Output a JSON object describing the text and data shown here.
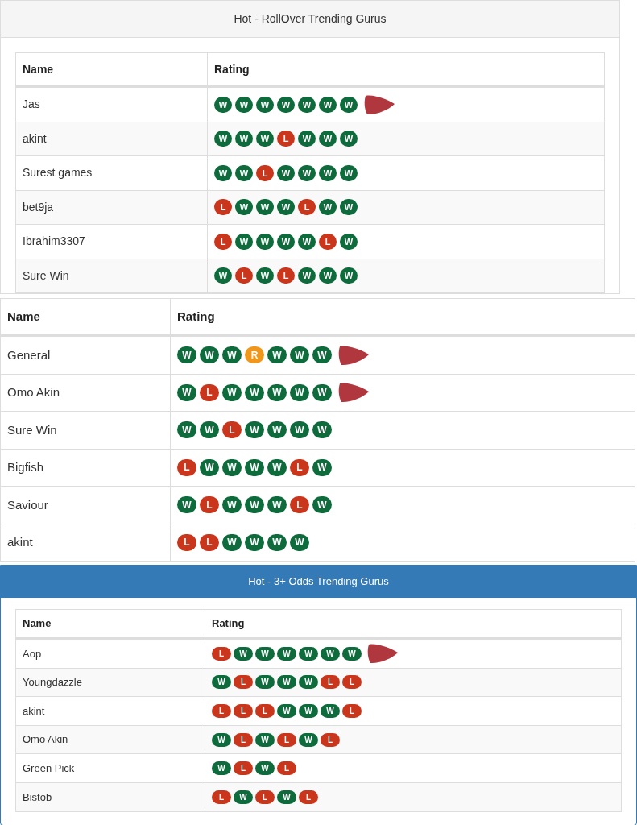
{
  "sections": [
    {
      "kind": "gray-panel",
      "title": "Hot - RollOver Trending Gurus",
      "columns": [
        "Name",
        "Rating"
      ],
      "rows": [
        {
          "name": "Jas",
          "marked": true,
          "results": [
            {
              "label": "W",
              "color": "#0d6b3c"
            },
            {
              "label": "W",
              "color": "#0d6b3c"
            },
            {
              "label": "W",
              "color": "#0d6b3c"
            },
            {
              "label": "W",
              "color": "#0d6b3c"
            },
            {
              "label": "W",
              "color": "#0d6b3c"
            },
            {
              "label": "W",
              "color": "#0d6b3c"
            },
            {
              "label": "W",
              "color": "#0d6b3c"
            }
          ]
        },
        {
          "name": "akint",
          "marked": false,
          "results": [
            {
              "label": "W",
              "color": "#0d6b3c"
            },
            {
              "label": "W",
              "color": "#0d6b3c"
            },
            {
              "label": "W",
              "color": "#0d6b3c"
            },
            {
              "label": "L",
              "color": "#c9361c"
            },
            {
              "label": "W",
              "color": "#0d6b3c"
            },
            {
              "label": "W",
              "color": "#0d6b3c"
            },
            {
              "label": "W",
              "color": "#0d6b3c"
            }
          ]
        },
        {
          "name": "Surest games",
          "marked": false,
          "results": [
            {
              "label": "W",
              "color": "#0d6b3c"
            },
            {
              "label": "W",
              "color": "#0d6b3c"
            },
            {
              "label": "L",
              "color": "#c9361c"
            },
            {
              "label": "W",
              "color": "#0d6b3c"
            },
            {
              "label": "W",
              "color": "#0d6b3c"
            },
            {
              "label": "W",
              "color": "#0d6b3c"
            },
            {
              "label": "W",
              "color": "#0d6b3c"
            }
          ]
        },
        {
          "name": "bet9ja",
          "marked": false,
          "results": [
            {
              "label": "L",
              "color": "#c9361c"
            },
            {
              "label": "W",
              "color": "#0d6b3c"
            },
            {
              "label": "W",
              "color": "#0d6b3c"
            },
            {
              "label": "W",
              "color": "#0d6b3c"
            },
            {
              "label": "L",
              "color": "#c9361c"
            },
            {
              "label": "W",
              "color": "#0d6b3c"
            },
            {
              "label": "W",
              "color": "#0d6b3c"
            }
          ]
        },
        {
          "name": "Ibrahim3307",
          "marked": false,
          "results": [
            {
              "label": "L",
              "color": "#c9361c"
            },
            {
              "label": "W",
              "color": "#0d6b3c"
            },
            {
              "label": "W",
              "color": "#0d6b3c"
            },
            {
              "label": "W",
              "color": "#0d6b3c"
            },
            {
              "label": "W",
              "color": "#0d6b3c"
            },
            {
              "label": "L",
              "color": "#c9361c"
            },
            {
              "label": "W",
              "color": "#0d6b3c"
            }
          ]
        },
        {
          "name": "Sure Win",
          "marked": false,
          "results": [
            {
              "label": "W",
              "color": "#0d6b3c"
            },
            {
              "label": "L",
              "color": "#c9361c"
            },
            {
              "label": "W",
              "color": "#0d6b3c"
            },
            {
              "label": "L",
              "color": "#c9361c"
            },
            {
              "label": "W",
              "color": "#0d6b3c"
            },
            {
              "label": "W",
              "color": "#0d6b3c"
            },
            {
              "label": "W",
              "color": "#0d6b3c"
            }
          ]
        }
      ]
    },
    {
      "kind": "plain",
      "columns": [
        "Name",
        "Rating"
      ],
      "rows": [
        {
          "name": "General",
          "marked": true,
          "results": [
            {
              "label": "W",
              "color": "#0d6b3c"
            },
            {
              "label": "W",
              "color": "#0d6b3c"
            },
            {
              "label": "W",
              "color": "#0d6b3c"
            },
            {
              "label": "R",
              "color": "#f0961a"
            },
            {
              "label": "W",
              "color": "#0d6b3c"
            },
            {
              "label": "W",
              "color": "#0d6b3c"
            },
            {
              "label": "W",
              "color": "#0d6b3c"
            }
          ]
        },
        {
          "name": "Omo Akin",
          "marked": true,
          "results": [
            {
              "label": "W",
              "color": "#0d6b3c"
            },
            {
              "label": "L",
              "color": "#c9361c"
            },
            {
              "label": "W",
              "color": "#0d6b3c"
            },
            {
              "label": "W",
              "color": "#0d6b3c"
            },
            {
              "label": "W",
              "color": "#0d6b3c"
            },
            {
              "label": "W",
              "color": "#0d6b3c"
            },
            {
              "label": "W",
              "color": "#0d6b3c"
            }
          ]
        },
        {
          "name": "Sure Win",
          "marked": false,
          "results": [
            {
              "label": "W",
              "color": "#0d6b3c"
            },
            {
              "label": "W",
              "color": "#0d6b3c"
            },
            {
              "label": "L",
              "color": "#c9361c"
            },
            {
              "label": "W",
              "color": "#0d6b3c"
            },
            {
              "label": "W",
              "color": "#0d6b3c"
            },
            {
              "label": "W",
              "color": "#0d6b3c"
            },
            {
              "label": "W",
              "color": "#0d6b3c"
            }
          ]
        },
        {
          "name": "Bigfish",
          "marked": false,
          "results": [
            {
              "label": "L",
              "color": "#c9361c"
            },
            {
              "label": "W",
              "color": "#0d6b3c"
            },
            {
              "label": "W",
              "color": "#0d6b3c"
            },
            {
              "label": "W",
              "color": "#0d6b3c"
            },
            {
              "label": "W",
              "color": "#0d6b3c"
            },
            {
              "label": "L",
              "color": "#c9361c"
            },
            {
              "label": "W",
              "color": "#0d6b3c"
            }
          ]
        },
        {
          "name": "Saviour",
          "marked": false,
          "results": [
            {
              "label": "W",
              "color": "#0d6b3c"
            },
            {
              "label": "L",
              "color": "#c9361c"
            },
            {
              "label": "W",
              "color": "#0d6b3c"
            },
            {
              "label": "W",
              "color": "#0d6b3c"
            },
            {
              "label": "W",
              "color": "#0d6b3c"
            },
            {
              "label": "L",
              "color": "#c9361c"
            },
            {
              "label": "W",
              "color": "#0d6b3c"
            }
          ]
        },
        {
          "name": "akint",
          "marked": false,
          "results": [
            {
              "label": "L",
              "color": "#c9361c"
            },
            {
              "label": "L",
              "color": "#c9361c"
            },
            {
              "label": "W",
              "color": "#0d6b3c"
            },
            {
              "label": "W",
              "color": "#0d6b3c"
            },
            {
              "label": "W",
              "color": "#0d6b3c"
            },
            {
              "label": "W",
              "color": "#0d6b3c"
            }
          ]
        }
      ]
    },
    {
      "kind": "blue-panel",
      "title": "Hot - 3+ Odds Trending Gurus",
      "columns": [
        "Name",
        "Rating"
      ],
      "rows": [
        {
          "name": "Aop",
          "marked": true,
          "results": [
            {
              "label": "L",
              "color": "#c9361c"
            },
            {
              "label": "W",
              "color": "#0d6b3c"
            },
            {
              "label": "W",
              "color": "#0d6b3c"
            },
            {
              "label": "W",
              "color": "#0d6b3c"
            },
            {
              "label": "W",
              "color": "#0d6b3c"
            },
            {
              "label": "W",
              "color": "#0d6b3c"
            },
            {
              "label": "W",
              "color": "#0d6b3c"
            }
          ]
        },
        {
          "name": "Youngdazzle",
          "marked": false,
          "results": [
            {
              "label": "W",
              "color": "#0d6b3c"
            },
            {
              "label": "L",
              "color": "#c9361c"
            },
            {
              "label": "W",
              "color": "#0d6b3c"
            },
            {
              "label": "W",
              "color": "#0d6b3c"
            },
            {
              "label": "W",
              "color": "#0d6b3c"
            },
            {
              "label": "L",
              "color": "#c9361c"
            },
            {
              "label": "L",
              "color": "#c9361c"
            }
          ]
        },
        {
          "name": "akint",
          "marked": false,
          "results": [
            {
              "label": "L",
              "color": "#c9361c"
            },
            {
              "label": "L",
              "color": "#c9361c"
            },
            {
              "label": "L",
              "color": "#c9361c"
            },
            {
              "label": "W",
              "color": "#0d6b3c"
            },
            {
              "label": "W",
              "color": "#0d6b3c"
            },
            {
              "label": "W",
              "color": "#0d6b3c"
            },
            {
              "label": "L",
              "color": "#c9361c"
            }
          ]
        },
        {
          "name": "Omo Akin",
          "marked": false,
          "results": [
            {
              "label": "W",
              "color": "#0d6b3c"
            },
            {
              "label": "L",
              "color": "#c9361c"
            },
            {
              "label": "W",
              "color": "#0d6b3c"
            },
            {
              "label": "L",
              "color": "#c9361c"
            },
            {
              "label": "W",
              "color": "#0d6b3c"
            },
            {
              "label": "L",
              "color": "#c9361c"
            }
          ]
        },
        {
          "name": "Green Pick",
          "marked": false,
          "results": [
            {
              "label": "W",
              "color": "#0d6b3c"
            },
            {
              "label": "L",
              "color": "#c9361c"
            },
            {
              "label": "W",
              "color": "#0d6b3c"
            },
            {
              "label": "L",
              "color": "#c9361c"
            }
          ]
        },
        {
          "name": "Bistob",
          "marked": false,
          "results": [
            {
              "label": "L",
              "color": "#c9361c"
            },
            {
              "label": "W",
              "color": "#0d6b3c"
            },
            {
              "label": "L",
              "color": "#c9361c"
            },
            {
              "label": "W",
              "color": "#0d6b3c"
            },
            {
              "label": "L",
              "color": "#c9361c"
            }
          ]
        }
      ]
    }
  ]
}
